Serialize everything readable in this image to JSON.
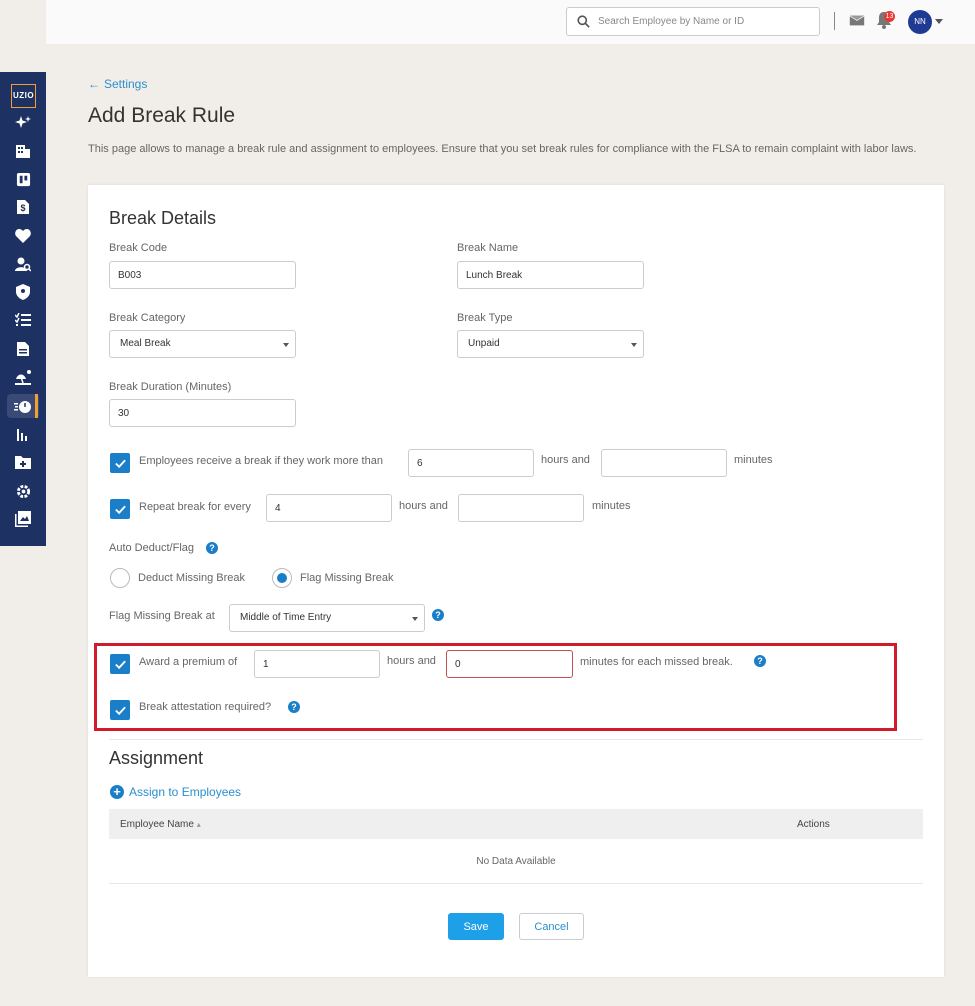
{
  "header": {
    "search_placeholder": "Search Employee by Name or ID",
    "notification_count": "13",
    "avatar_initials": "NN"
  },
  "sidebar": {
    "logo": "UZIO",
    "icons": [
      "sparkle-icon",
      "building-icon",
      "board-icon",
      "dollar-doc-icon",
      "heart-icon",
      "person-search-icon",
      "shield-icon",
      "checklist-icon",
      "document-icon",
      "vacation-icon",
      "timer-icon",
      "bar-chart-icon",
      "folder-plus-icon",
      "gear-icon",
      "gallery-icon"
    ],
    "active": "timer-icon"
  },
  "breadcrumb": {
    "back_label": "Settings"
  },
  "page": {
    "title": "Add Break Rule",
    "description": "This page allows to manage a break rule and assignment to employees. Ensure that you set break rules for compliance with the FLSA to remain complaint with labor laws."
  },
  "break_details": {
    "title": "Break Details",
    "break_code_label": "Break Code",
    "break_code_value": "B003",
    "break_name_label": "Break Name",
    "break_name_value": "Lunch Break",
    "break_category_label": "Break Category",
    "break_category_value": "Meal Break",
    "break_type_label": "Break Type",
    "break_type_value": "Unpaid",
    "duration_label": "Break Duration (Minutes)",
    "duration_value": "30",
    "work_more_label": "Employees receive a break if they work more than",
    "work_more_hours": "6",
    "work_more_minutes": "",
    "hours_and": "hours and",
    "minutes": "minutes",
    "repeat_label": "Repeat break for every",
    "repeat_hours": "4",
    "repeat_minutes": "",
    "auto_label": "Auto Deduct/Flag",
    "deduct_label": "Deduct Missing Break",
    "flag_label": "Flag Missing Break",
    "flag_at_label": "Flag Missing Break at",
    "flag_at_value": "Middle of Time Entry",
    "award_label": "Award a premium of",
    "award_hours": "1",
    "award_minutes": "0",
    "award_suffix": "minutes for each missed break.",
    "attestation_label": "Break attestation required?"
  },
  "assignment": {
    "title": "Assignment",
    "assign_link": "Assign to Employees",
    "columns": [
      "Employee Name",
      "Actions"
    ],
    "sort_indicator": "▴",
    "empty_text": "No Data Available"
  },
  "actions": {
    "save": "Save",
    "cancel": "Cancel"
  },
  "colors": {
    "accent": "#1a7fc8",
    "sidebar": "#1d3262",
    "highlight": "#d11a2a",
    "save": "#1ea0e8"
  }
}
